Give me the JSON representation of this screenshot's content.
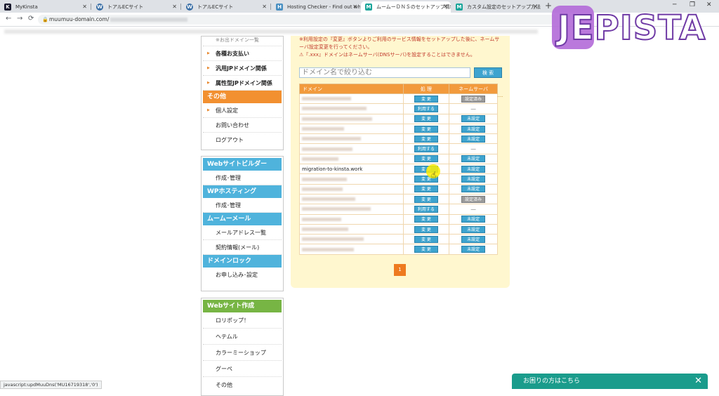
{
  "browser": {
    "tabs": [
      {
        "title": "MyKinsta",
        "favicon": "K",
        "favicon_color": "#1a1a2e"
      },
      {
        "title": "トアルECサイト",
        "favicon": "W",
        "favicon_color": "#3a6ea5"
      },
      {
        "title": "トアルECサイト",
        "favicon": "W",
        "favicon_color": "#3a6ea5"
      },
      {
        "title": "Hosting Checker - Find out who",
        "favicon": "H",
        "favicon_color": "#4a90c2"
      },
      {
        "title": "ムームーＤＮＳのセットアップ情報変",
        "favicon": "M",
        "favicon_color": "#1aa59a"
      },
      {
        "title": "カスタム設定のセットアップ方法 - ム",
        "favicon": "M",
        "favicon_color": "#1aa59a"
      }
    ],
    "new_tab": "+",
    "url": "muumuu-domain.com/",
    "status": "javascript:updMuuDns('MU16719318','0')"
  },
  "logo": {
    "text": "JEPISTA"
  },
  "sidebar": {
    "group1": {
      "cut_item": "※お出ドメイン一覧",
      "items": [
        "各種お支払い",
        "汎用JPドメイン関係",
        "属性型JPドメイン関係"
      ]
    },
    "other_head": "その他",
    "other_items": [
      "個人設定",
      "お問い合わせ",
      "ログアウト"
    ],
    "group2": [
      {
        "head": "Webサイトビルダー",
        "items": [
          "作成･管理"
        ]
      },
      {
        "head": "WPホスティング",
        "items": [
          "作成･管理"
        ]
      },
      {
        "head": "ムームーメール",
        "items": [
          "メールアドレス一覧",
          "契約情報(メール)"
        ]
      },
      {
        "head": "ドメインロック",
        "items": [
          "お申し込み･設定"
        ]
      }
    ],
    "group3": {
      "head": "Webサイト作成",
      "items": [
        "ロリポップ！",
        "ヘテムル",
        "カラーミーショップ",
        "グーペ",
        "その他"
      ]
    }
  },
  "notice": {
    "line1": "※利用設定の『変更』ボタンよりご利用のサービス情報をセットアップした後に、ネームサ",
    "line2": "ーバ設定変更を行ってください。",
    "line3": "⚠『.xxx』ドメインはネームサーバ(DNSサーバ)を設定することはできません。"
  },
  "filter": {
    "placeholder": "ドメイン名で絞り込む",
    "button": "検 索"
  },
  "table": {
    "headers": [
      "ドメイン",
      "処 理",
      "ネームサーバ"
    ],
    "rows": [
      {
        "domain": "",
        "op": "変 更",
        "ns": "設定済み",
        "ns_style": "gray"
      },
      {
        "domain": "",
        "op": "利用する",
        "ns": "―",
        "ns_style": "dash"
      },
      {
        "domain": "",
        "op": "変 更",
        "ns": "未設定",
        "ns_style": "btn"
      },
      {
        "domain": "",
        "op": "変 更",
        "ns": "未設定",
        "ns_style": "btn"
      },
      {
        "domain": "",
        "op": "変 更",
        "ns": "未設定",
        "ns_style": "btn"
      },
      {
        "domain": "",
        "op": "利用する",
        "ns": "―",
        "ns_style": "dash"
      },
      {
        "domain": "",
        "op": "変 更",
        "ns": "未設定",
        "ns_style": "btn"
      },
      {
        "domain": "migration-to-kinsta.work",
        "op": "変 更",
        "ns": "未設定",
        "ns_style": "btn"
      },
      {
        "domain": "",
        "op": "変 更",
        "ns": "未設定",
        "ns_style": "btn"
      },
      {
        "domain": "",
        "op": "変 更",
        "ns": "未設定",
        "ns_style": "btn"
      },
      {
        "domain": "",
        "op": "変 更",
        "ns": "設定済み",
        "ns_style": "gray"
      },
      {
        "domain": "",
        "op": "利用する",
        "ns": "―",
        "ns_style": "dash"
      },
      {
        "domain": "",
        "op": "変 更",
        "ns": "未設定",
        "ns_style": "btn"
      },
      {
        "domain": "",
        "op": "変 更",
        "ns": "未設定",
        "ns_style": "btn"
      },
      {
        "domain": "",
        "op": "変 更",
        "ns": "未設定",
        "ns_style": "btn"
      },
      {
        "domain": "",
        "op": "変 更",
        "ns": "未設定",
        "ns_style": "btn"
      }
    ]
  },
  "pager": {
    "current": "1"
  },
  "help": {
    "label": "お困りの方はこちら",
    "close": "✕"
  }
}
